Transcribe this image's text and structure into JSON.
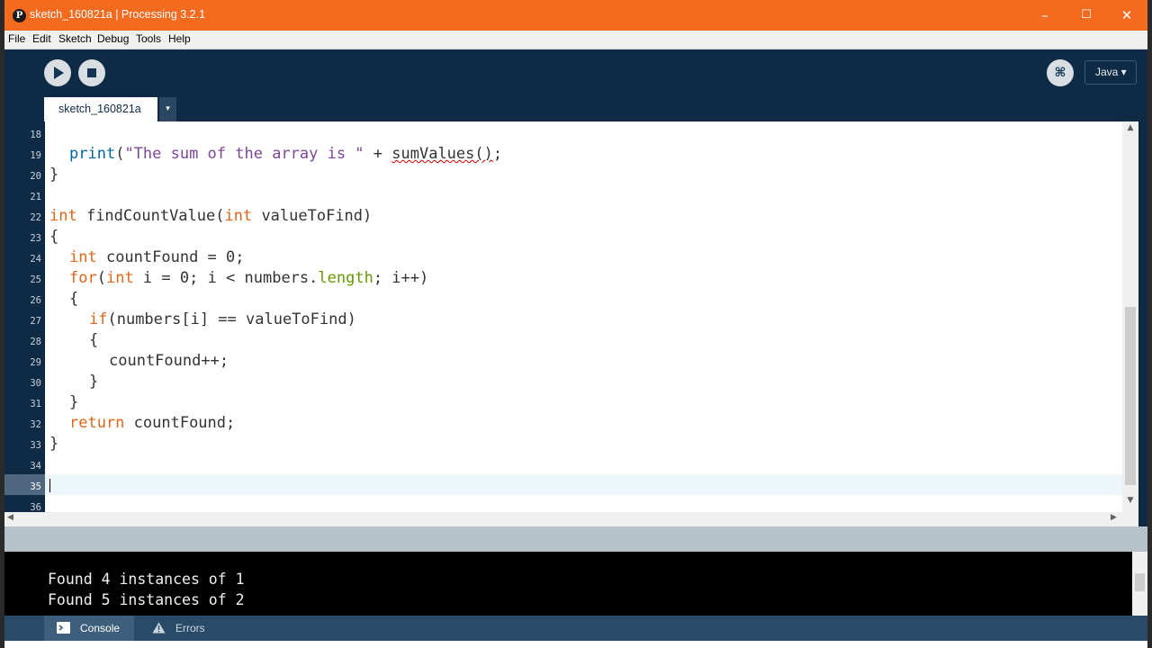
{
  "window": {
    "title": "sketch_160821a | Processing 3.2.1",
    "logo": "P",
    "controls": {
      "minimize": "–",
      "maximize": "☐",
      "close": "✕"
    },
    "accent": "#f46a1e"
  },
  "menu": [
    "File",
    "Edit",
    "Sketch",
    "Debug",
    "Tools",
    "Help"
  ],
  "toolbar": {
    "mode": "Java ▾",
    "debug_icon": "debug-icon",
    "run_icon": "play-icon",
    "stop_icon": "stop-icon"
  },
  "tabs": {
    "active": "sketch_160821a",
    "menu_arrow": "▾"
  },
  "editor": {
    "line_numbers": [
      "18",
      "19",
      "20",
      "21",
      "22",
      "23",
      "24",
      "25",
      "26",
      "27",
      "28",
      "29",
      "30",
      "31",
      "32",
      "33",
      "34",
      "35",
      "36"
    ],
    "current_line": "35",
    "code": {
      "l19_print": "print",
      "l19_paren": "(",
      "l19_str": "\"The sum of the array is \"",
      "l19_plus": " + ",
      "l19_call": "sumValues()",
      "l19_end": ";",
      "l20": "}",
      "l22_int": "int",
      "l22_name": " findCountValue(",
      "l22_int2": "int",
      "l22_rest": " valueToFind)",
      "l23": "{",
      "l24_int": "int",
      "l24_rest": " countFound = 0;",
      "l25_for": "for",
      "l25_paren": "(",
      "l25_int": "int",
      "l25_mid": " i = 0; i < numbers.",
      "l25_length": "length",
      "l25_end": "; i++)",
      "l26": "{",
      "l27_if": "if",
      "l27_rest": "(numbers[i] == valueToFind)",
      "l28": "{",
      "l29": "countFound++;",
      "l30": "}",
      "l31": "}",
      "l32_return": "return",
      "l32_rest": " countFound;",
      "l33": "}"
    }
  },
  "console": {
    "lines": [
      "Found 4 instances of 1",
      "Found 5 instances of 2"
    ]
  },
  "bottom_tabs": {
    "console": "Console",
    "errors": "Errors"
  }
}
